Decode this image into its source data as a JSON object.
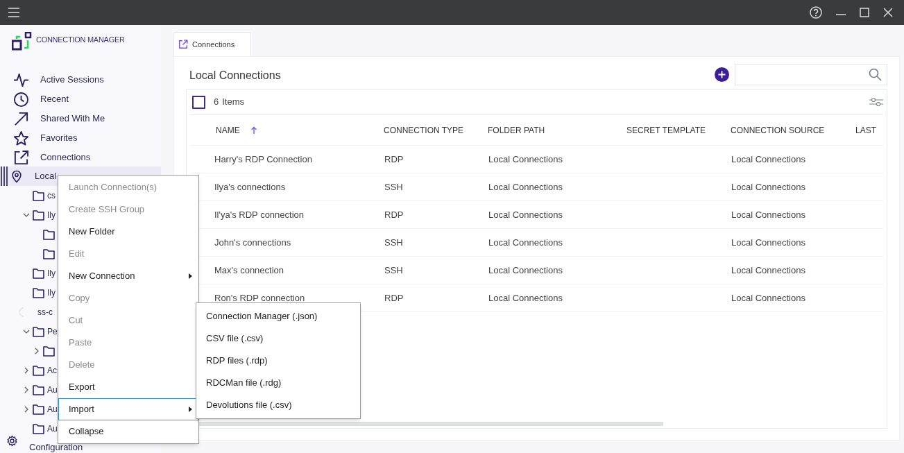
{
  "app": {
    "title": "CONNECTION MANAGER"
  },
  "nav": [
    {
      "label": "Active Sessions",
      "kind": "pulse"
    },
    {
      "label": "Recent",
      "kind": "clock"
    },
    {
      "label": "Shared With Me",
      "kind": "arrow"
    },
    {
      "label": "Favorites",
      "kind": "star"
    },
    {
      "label": "Connections",
      "kind": "external"
    }
  ],
  "tree": {
    "label": "Local",
    "selected": true,
    "children": [
      {
        "label": "cs",
        "kind": "folder"
      },
      {
        "label": "Ily",
        "kind": "folder",
        "expanded": true,
        "children": [
          {
            "kind": "folder"
          },
          {
            "kind": "folder"
          }
        ]
      },
      {
        "label": "Ily",
        "kind": "folder"
      },
      {
        "label": "Ily",
        "kind": "folder"
      },
      {
        "label": "ss-c",
        "kind": "loading"
      },
      {
        "label": "Pe",
        "kind": "folder",
        "expanded": true,
        "children": [
          {
            "kind": "folder",
            "expanded": false
          }
        ]
      },
      {
        "label": "Ac",
        "kind": "folder",
        "expanded": false
      },
      {
        "label": "Au",
        "kind": "folder",
        "expanded": false
      },
      {
        "label": "Au",
        "kind": "folder",
        "expanded": false
      },
      {
        "label": "Au",
        "kind": "folder"
      }
    ]
  },
  "configuration": {
    "label": "Configuration"
  },
  "tabs": [
    {
      "label": "Connections",
      "selected": true
    }
  ],
  "panel": {
    "title": "Local Connections",
    "count": "6",
    "count_label": "Items",
    "select_all": {
      "checked": false
    }
  },
  "table": {
    "columns": [
      {
        "label": "NAME",
        "sorted": true
      },
      {
        "label": "CONNECTION TYPE"
      },
      {
        "label": "FOLDER PATH"
      },
      {
        "label": "SECRET TEMPLATE"
      },
      {
        "label": "CONNECTION SOURCE"
      },
      {
        "label": "LAST"
      }
    ],
    "rows": [
      [
        "Harry's RDP Connection",
        "RDP",
        "Local Connections",
        "",
        "Local Connections"
      ],
      [
        "Ilya's connections",
        "SSH",
        "Local Connections",
        "",
        "Local Connections"
      ],
      [
        "Il'ya's RDP connection",
        "RDP",
        "Local Connections",
        "",
        "Local Connections"
      ],
      [
        "John's connections",
        "SSH",
        "Local Connections",
        "",
        "Local Connections"
      ],
      [
        "Max's connection",
        "SSH",
        "Local Connections",
        "",
        "Local Connections"
      ],
      [
        "Ron's RDP connection",
        "RDP",
        "Local Connections",
        "",
        "Local Connections"
      ]
    ]
  },
  "context_menu": [
    {
      "label": "Launch Connection(s)",
      "disabled": true
    },
    {
      "label": "Create SSH Group",
      "disabled": true
    },
    {
      "label": "New Folder",
      "disabled": false
    },
    {
      "label": "Edit",
      "disabled": true
    },
    {
      "label": "New Connection",
      "disabled": false,
      "submenu": true
    },
    {
      "label": "Copy",
      "disabled": true
    },
    {
      "label": "Cut",
      "disabled": true
    },
    {
      "label": "Paste",
      "disabled": true
    },
    {
      "label": "Delete",
      "disabled": true
    },
    {
      "label": "Export",
      "disabled": false
    },
    {
      "label": "Import",
      "disabled": false,
      "submenu": true,
      "selected": true
    },
    {
      "label": "Collapse",
      "disabled": false
    }
  ],
  "submenu": [
    "Connection Manager (.json)",
    "CSV file (.csv)",
    "RDP files (.rdp)",
    "RDCMan file (.rdg)",
    "Devolutions file (.csv)"
  ]
}
